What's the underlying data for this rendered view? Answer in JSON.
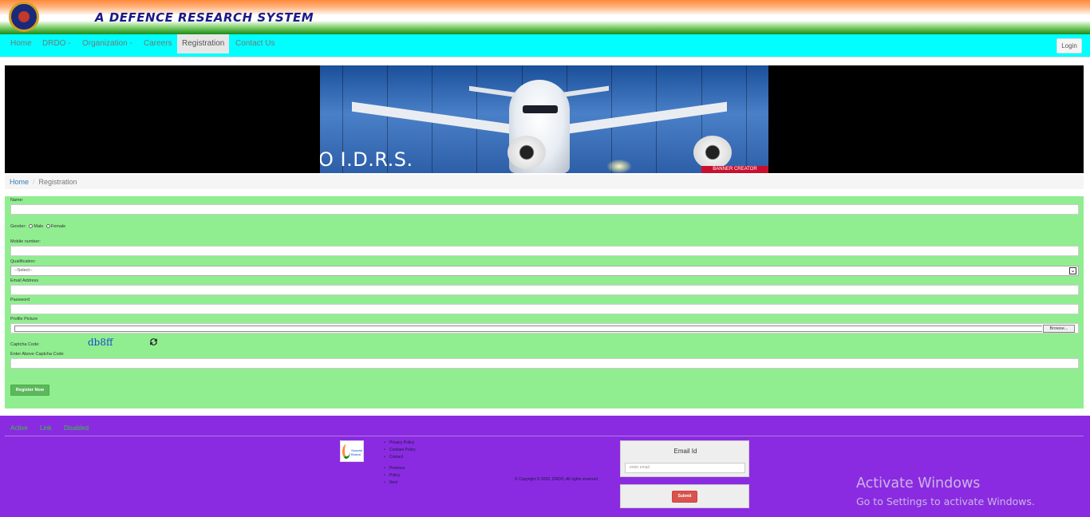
{
  "header": {
    "title": "A DEFENCE RESEARCH SYSTEM",
    "logo_icon": "drdo-emblem-icon"
  },
  "navbar": {
    "items": [
      {
        "label": "Home"
      },
      {
        "label": "DRDO -"
      },
      {
        "label": "Organization -"
      },
      {
        "label": "Careers"
      },
      {
        "label": "Registration",
        "active": true
      },
      {
        "label": "Contact Us"
      }
    ],
    "login_label": "Login",
    "background": "#00ffff"
  },
  "banner": {
    "text": "O I.D.R.S.",
    "badge": "BANNER CREATOR"
  },
  "breadcrumb": {
    "home": "Home",
    "separator": "/",
    "current": "Registration"
  },
  "form": {
    "background": "#90ee90",
    "name_label": "Name:",
    "gender_label": "Gender:",
    "gender_male": "Male",
    "gender_female": "Female",
    "mobile_label": "Mobile number:",
    "qualification_label": "Qualification:",
    "qualification_selected": "--Select--",
    "email_label": "Email Address",
    "password_label": "Password",
    "profile_label": "Profile Picture",
    "browse_label": "Browse...",
    "captcha_label": "Captcha Code:",
    "captcha_value": "db8ff",
    "captcha_refresh_icon": "refresh-icon",
    "captcha_input_label": "Enter Above Captcha Code",
    "register_label": "Register Now"
  },
  "footer": {
    "background": "#8a2be2",
    "nav": [
      "Active",
      "Link",
      "Disabled"
    ],
    "links_1": [
      "Privacy Policy",
      "Cookies Policy",
      "Contact"
    ],
    "links_2": [
      "Previous",
      "Policy",
      "Next"
    ],
    "logo_text": "Swachh Bharat",
    "copyright": "© Copyright © 2020, DRDO, All rights reserved",
    "email_label": "Email Id",
    "email_placeholder": "enter email",
    "submit_label": "Submit"
  },
  "watermark": {
    "title": "Activate Windows",
    "subtitle": "Go to Settings to activate Windows."
  }
}
